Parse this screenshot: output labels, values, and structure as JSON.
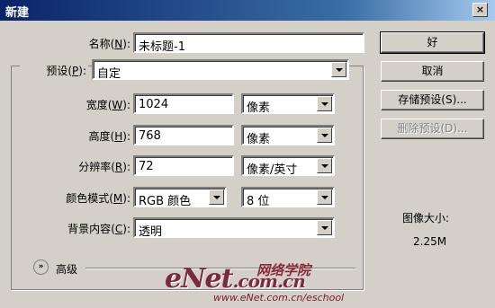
{
  "window": {
    "title": "新建",
    "close_glyph": "×"
  },
  "form": {
    "name": {
      "label": "名称",
      "key": "N",
      "value": "未标题-1"
    },
    "preset": {
      "label": "预设",
      "key": "P",
      "value": "自定"
    },
    "width": {
      "label": "宽度",
      "key": "W",
      "value": "1024",
      "unit": "像素"
    },
    "height": {
      "label": "高度",
      "key": "H",
      "value": "768",
      "unit": "像素"
    },
    "resolution": {
      "label": "分辨率",
      "key": "R",
      "value": "72",
      "unit": "像素/英寸"
    },
    "color_mode": {
      "label": "颜色模式",
      "key": "M",
      "value": "RGB 颜色",
      "depth": "8 位"
    },
    "background": {
      "label": "背景内容",
      "key": "C",
      "value": "透明"
    },
    "advanced": {
      "label": "高级",
      "icon_glyph": "»"
    }
  },
  "buttons": {
    "ok": "好",
    "cancel": "取消",
    "save_preset": "存储预设(S)...",
    "delete_preset": "删除预设(D)..."
  },
  "image_size": {
    "label": "图像大小:",
    "value": "2.25M"
  },
  "watermark": {
    "logo_main": "eNet",
    "logo_suffix": ".com.cn",
    "cn": "网络学院",
    "url": "www.eNet.com.cn/eschool"
  }
}
